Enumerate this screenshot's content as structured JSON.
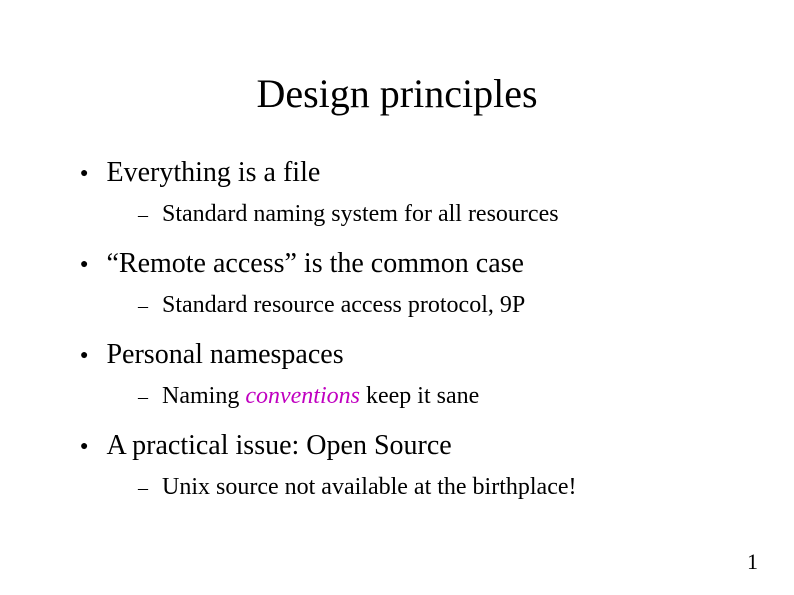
{
  "title": "Design principles",
  "items": [
    {
      "text": "Everything is a file",
      "sub": {
        "before": "Standard naming system for all resources",
        "emph": "",
        "after": ""
      }
    },
    {
      "text": "“Remote access” is the common case",
      "sub": {
        "before": "Standard resource access protocol, 9P",
        "emph": "",
        "after": ""
      }
    },
    {
      "text": "Personal namespaces",
      "sub": {
        "before": "Naming ",
        "emph": "conventions",
        "after": " keep it sane"
      }
    },
    {
      "text": "A practical issue: Open Source",
      "sub": {
        "before": "Unix source not available at the birthplace!",
        "emph": "",
        "after": ""
      }
    }
  ],
  "page_number": "1"
}
